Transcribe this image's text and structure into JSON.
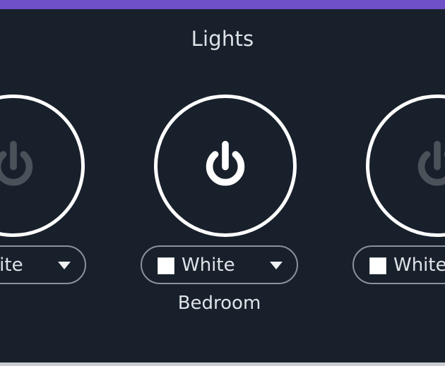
{
  "header": {
    "title": "Lights"
  },
  "lights": [
    {
      "room": "",
      "color_label": "White",
      "state": "off"
    },
    {
      "room": "Bedroom",
      "color_label": "White",
      "state": "on"
    },
    {
      "room": "",
      "color_label": "White",
      "state": "off"
    }
  ],
  "colors": {
    "accent": "#7050c8",
    "background": "#18202b",
    "power_on": "#ffffff",
    "power_off": "#4a5159",
    "swatch_white": "#ffffff"
  },
  "icons": {
    "power": "power-icon",
    "dropdown": "chevron-down-icon"
  }
}
